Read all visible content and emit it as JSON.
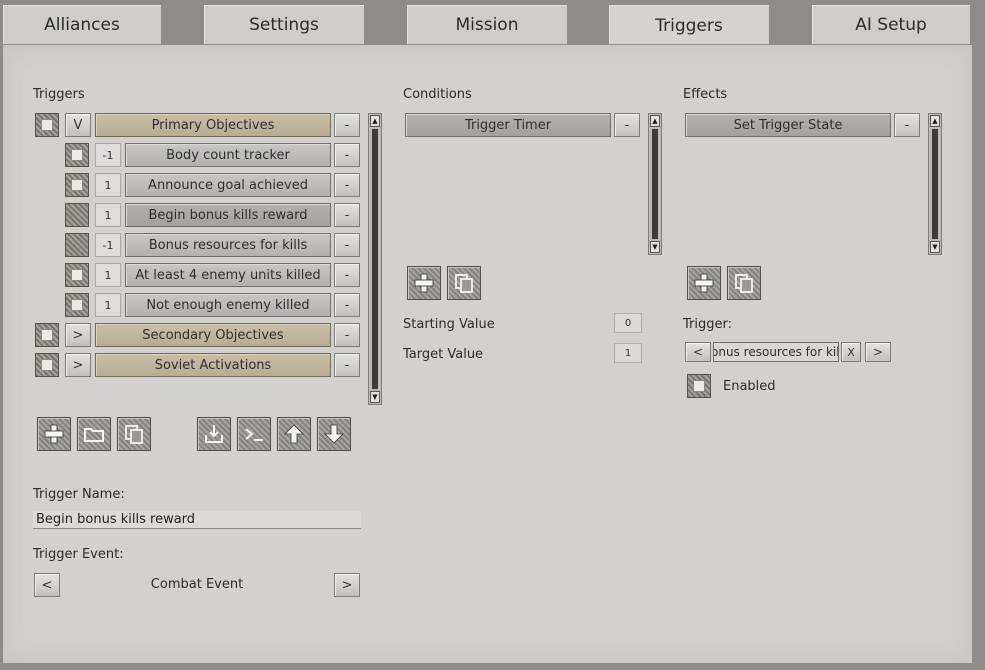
{
  "tabs": [
    {
      "label": "Alliances"
    },
    {
      "label": "Settings"
    },
    {
      "label": "Mission"
    },
    {
      "label": "Triggers"
    },
    {
      "label": "AI Setup"
    }
  ],
  "triggers": {
    "heading": "Triggers",
    "groups": [
      {
        "toggle": "V",
        "label": "Primary Objectives",
        "remove": "-"
      },
      {
        "toggle": ">",
        "label": "Secondary Objectives",
        "remove": "-"
      },
      {
        "toggle": ">",
        "label": "Soviet Activations",
        "remove": "-"
      }
    ],
    "items": [
      {
        "value": "-1",
        "label": "Body count tracker",
        "remove": "-"
      },
      {
        "value": "1",
        "label": "Announce goal achieved",
        "remove": "-"
      },
      {
        "value": "1",
        "label": "Begin bonus kills reward",
        "remove": "-"
      },
      {
        "value": "-1",
        "label": "Bonus resources for kills",
        "remove": "-"
      },
      {
        "value": "1",
        "label": "At least 4 enemy units killed",
        "remove": "-"
      },
      {
        "value": "1",
        "label": "Not enough enemy killed",
        "remove": "-"
      }
    ],
    "name_label": "Trigger Name:",
    "name_value": "Begin bonus kills reward",
    "event_label": "Trigger Event:",
    "event_prev": "<",
    "event_value": "Combat Event",
    "event_next": ">"
  },
  "conditions": {
    "heading": "Conditions",
    "items": [
      {
        "label": "Trigger Timer",
        "remove": "-"
      }
    ],
    "starting_label": "Starting Value",
    "starting_value": "0",
    "target_label": "Target Value",
    "target_value": "1"
  },
  "effects": {
    "heading": "Effects",
    "items": [
      {
        "label": "Set Trigger State",
        "remove": "-"
      }
    ],
    "trigger_label": "Trigger:",
    "trigger_prev": "<",
    "trigger_value": "Bonus resources for kills",
    "trigger_clear": "X",
    "trigger_next": ">",
    "enabled_label": "Enabled"
  },
  "icons": [
    "plus-icon",
    "folder-icon",
    "copy-icon",
    "import-icon",
    "terminal-icon",
    "arrow-up-icon",
    "arrow-down-icon"
  ]
}
